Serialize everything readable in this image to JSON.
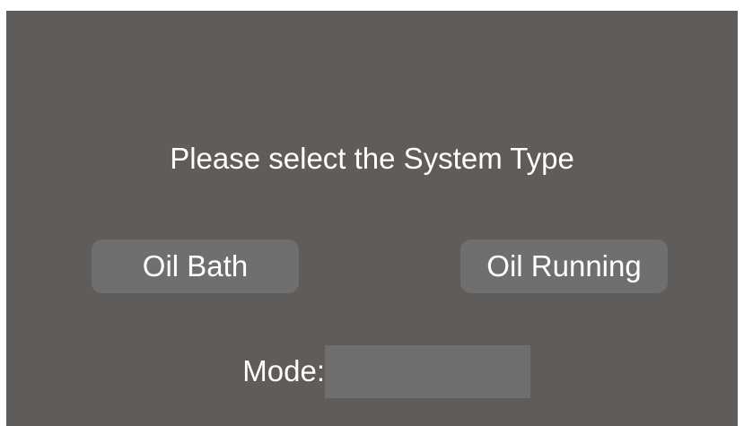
{
  "prompt": {
    "text": "Please select the System Type"
  },
  "buttons": {
    "oil_bath": "Oil Bath",
    "oil_running": "Oil Running"
  },
  "mode": {
    "label": "Mode:",
    "value": ""
  },
  "colors": {
    "background": "#5f5c5a",
    "control": "#6f6f6f",
    "text": "#ffffff"
  }
}
